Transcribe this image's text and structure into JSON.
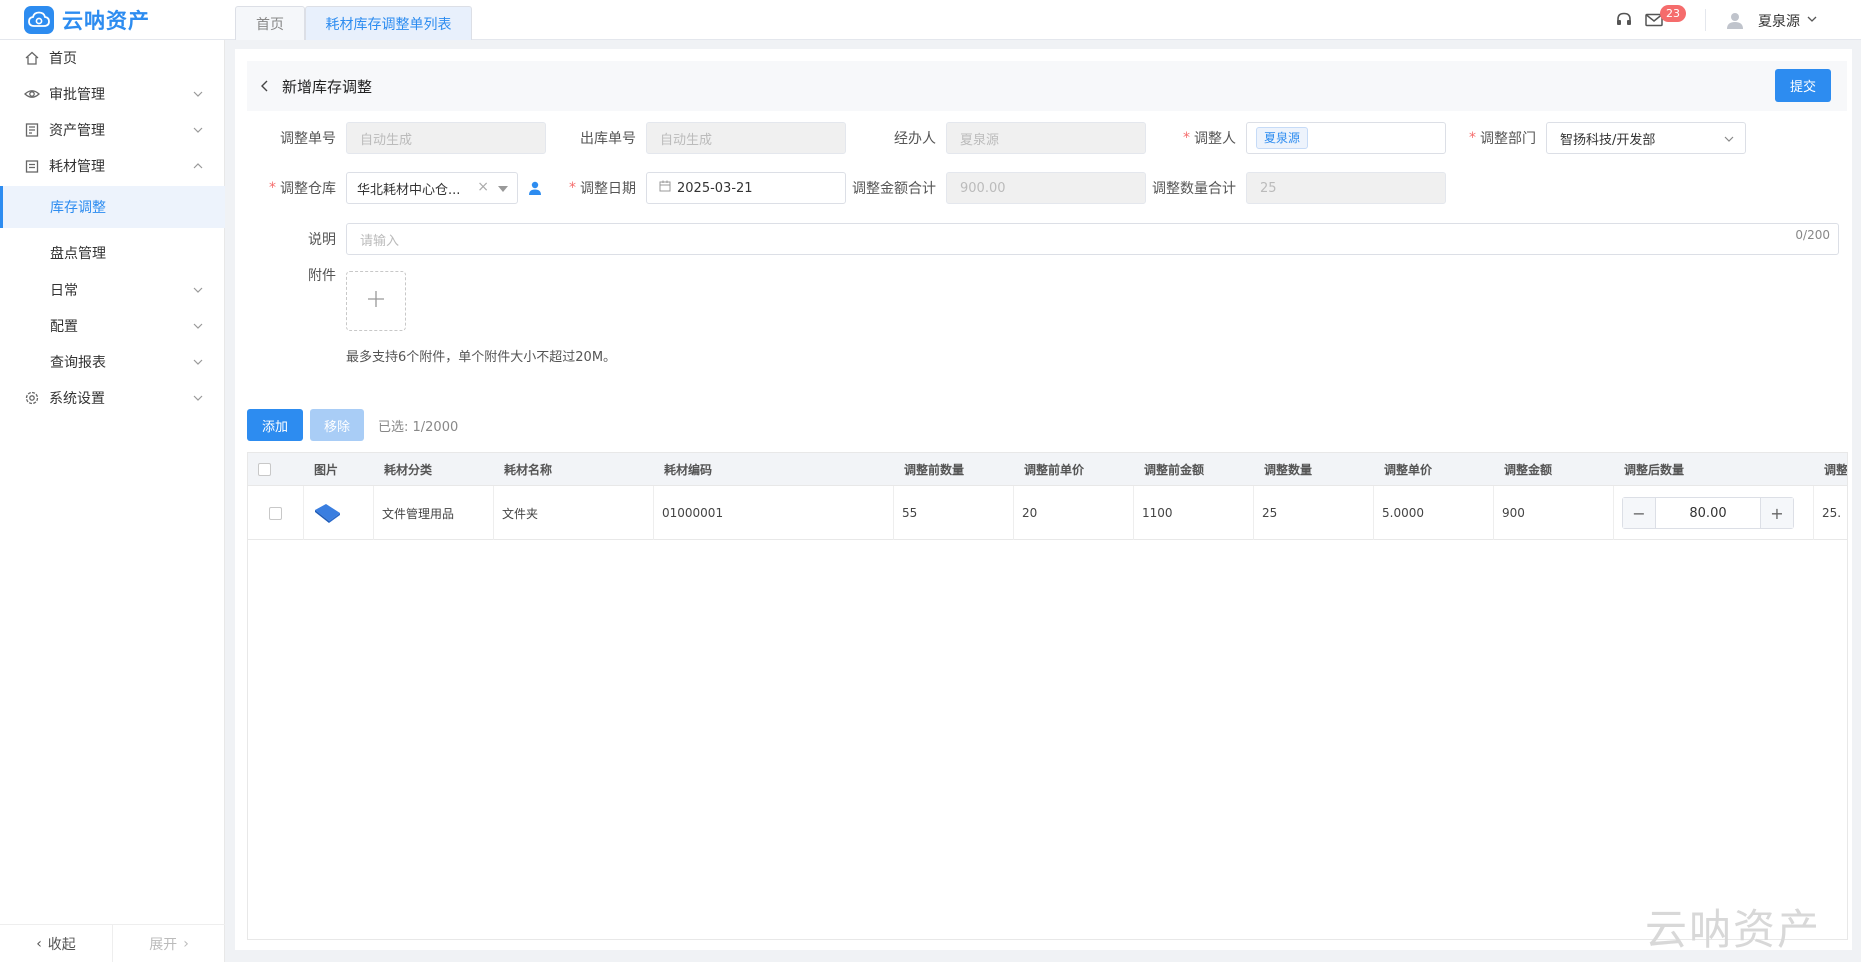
{
  "app": {
    "name": "云呐资产",
    "watermark": "云呐资产"
  },
  "tabs": [
    {
      "label": "首页"
    },
    {
      "label": "耗材库存调整单列表"
    }
  ],
  "header": {
    "notification_count": "23",
    "user_name": "夏泉源"
  },
  "sidebar": {
    "items": [
      {
        "label": "首页"
      },
      {
        "label": "审批管理"
      },
      {
        "label": "资产管理"
      },
      {
        "label": "耗材管理"
      },
      {
        "label": "库存调整"
      },
      {
        "label": "盘点管理"
      },
      {
        "label": "日常"
      },
      {
        "label": "配置"
      },
      {
        "label": "查询报表"
      },
      {
        "label": "系统设置"
      }
    ],
    "collapse_label": "收起",
    "expand_label": "展开"
  },
  "page": {
    "title": "新增库存调整",
    "submit_label": "提交"
  },
  "form": {
    "order_no": {
      "label": "调整单号",
      "placeholder": "自动生成"
    },
    "outbound_no": {
      "label": "出库单号",
      "placeholder": "自动生成"
    },
    "handler": {
      "label": "经办人",
      "value": "夏泉源"
    },
    "adjuster": {
      "label": "调整人",
      "value": "夏泉源"
    },
    "department": {
      "label": "调整部门",
      "value": "智扬科技/开发部"
    },
    "warehouse": {
      "label": "调整仓库",
      "value": "华北耗材中心仓..."
    },
    "date": {
      "label": "调整日期",
      "value": "2025-03-21"
    },
    "amount_total": {
      "label": "调整金额合计",
      "value": "900.00"
    },
    "qty_total": {
      "label": "调整数量合计",
      "value": "25"
    },
    "remark": {
      "label": "说明",
      "placeholder": "请输入",
      "counter": "0/200"
    },
    "attachment": {
      "label": "附件",
      "hint": "最多支持6个附件，单个附件大小不超过20M。"
    }
  },
  "toolbar": {
    "add_label": "添加",
    "remove_label": "移除",
    "selected": "已选: 1/2000"
  },
  "table": {
    "columns": [
      "图片",
      "耗材分类",
      "耗材名称",
      "耗材编码",
      "调整前数量",
      "调整前单价",
      "调整前金额",
      "调整数量",
      "调整单价",
      "调整金额",
      "调整后数量",
      "调整"
    ],
    "rows": [
      {
        "category": "文件管理用品",
        "name": "文件夹",
        "code": "01000001",
        "qty_before": "55",
        "price_before": "20",
        "amount_before": "1100",
        "adj_qty": "25",
        "adj_price": "5.0000",
        "adj_amount": "900",
        "qty_after": "80.00",
        "cut_cell": "25."
      }
    ]
  }
}
